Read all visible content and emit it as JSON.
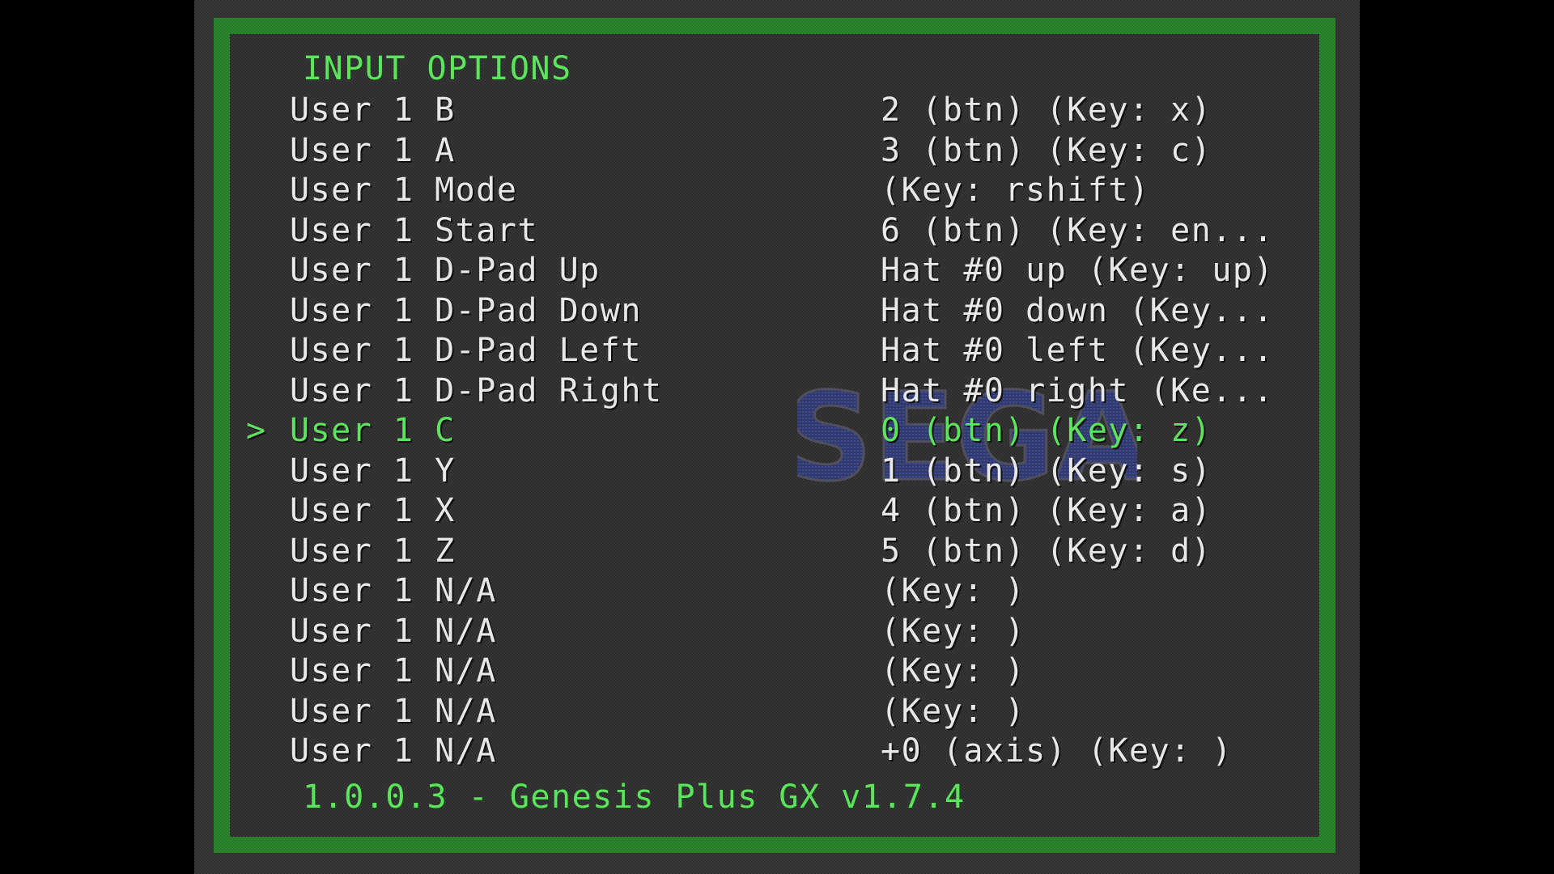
{
  "menu": {
    "title": "INPUT OPTIONS",
    "cursor_symbol": ">",
    "selected_index": 8,
    "items": [
      {
        "label": "User 1 B",
        "value": "2 (btn) (Key: x)"
      },
      {
        "label": "User 1 A",
        "value": "3 (btn) (Key: c)"
      },
      {
        "label": "User 1 Mode",
        "value": "(Key: rshift)"
      },
      {
        "label": "User 1 Start",
        "value": "6 (btn) (Key: en..."
      },
      {
        "label": "User 1 D-Pad Up",
        "value": "Hat #0 up (Key: up)"
      },
      {
        "label": "User 1 D-Pad Down",
        "value": "Hat #0 down (Key..."
      },
      {
        "label": "User 1 D-Pad Left",
        "value": "Hat #0 left (Key..."
      },
      {
        "label": "User 1 D-Pad Right",
        "value": "Hat #0 right (Ke..."
      },
      {
        "label": "User 1 C",
        "value": "0 (btn) (Key: z)"
      },
      {
        "label": "User 1 Y",
        "value": "1 (btn) (Key: s)"
      },
      {
        "label": "User 1 X",
        "value": "4 (btn) (Key: a)"
      },
      {
        "label": "User 1 Z",
        "value": "5 (btn) (Key: d)"
      },
      {
        "label": "User 1 N/A",
        "value": "(Key: )"
      },
      {
        "label": "User 1 N/A",
        "value": "(Key: )"
      },
      {
        "label": "User 1 N/A",
        "value": "(Key: )"
      },
      {
        "label": "User 1 N/A",
        "value": "(Key: )"
      },
      {
        "label": "User 1 N/A",
        "value": "+0 (axis) (Key: )"
      }
    ]
  },
  "footer": {
    "version": "1.0.0.3 - Genesis Plus GX v1.7.4"
  },
  "logo": {
    "text": "SEGA",
    "icon": "sega-logo"
  },
  "colors": {
    "highlight": "#5ee35e",
    "text": "#e8e8e8",
    "frame": "#2f8a2f",
    "logo_fill": "#3a4a8a"
  }
}
